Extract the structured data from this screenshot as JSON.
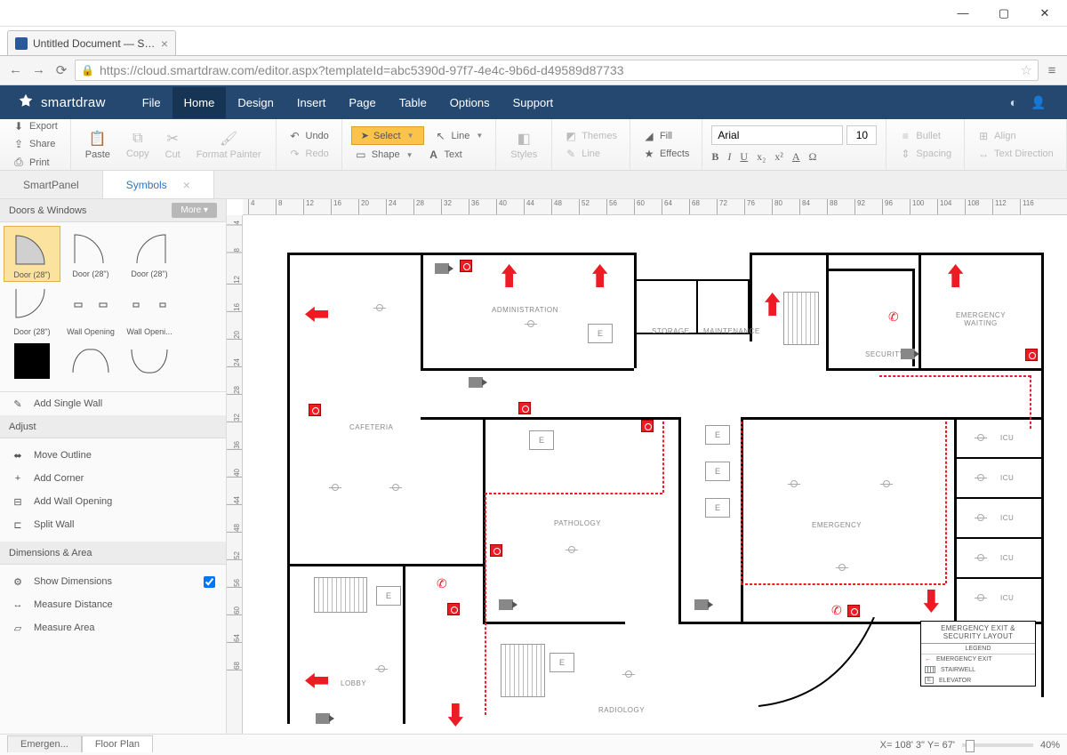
{
  "window": {
    "title": "Untitled Document — Sm..."
  },
  "browser": {
    "tab_title": "Untitled Document — Sm...",
    "url": "https://cloud.smartdraw.com/editor.aspx?templateId=abc5390d-97f7-4e4c-9b6d-d49589d87733"
  },
  "brand": "smartdraw",
  "menubar": {
    "items": [
      "File",
      "Home",
      "Design",
      "Insert",
      "Page",
      "Table",
      "Options",
      "Support"
    ],
    "active": "Home"
  },
  "ribbon": {
    "export": "Export",
    "share": "Share",
    "print": "Print",
    "paste": "Paste",
    "copy": "Copy",
    "cut": "Cut",
    "format_painter": "Format Painter",
    "undo": "Undo",
    "redo": "Redo",
    "select": "Select",
    "shape": "Shape",
    "line": "Line",
    "text": "Text",
    "styles": "Styles",
    "themes": "Themes",
    "line2": "Line",
    "fill": "Fill",
    "effects": "Effects",
    "font": "Arial",
    "font_size": "10",
    "bullet": "Bullet",
    "spacing": "Spacing",
    "align": "Align",
    "text_direction": "Text Direction"
  },
  "panel_tabs": {
    "smartpanel": "SmartPanel",
    "symbols": "Symbols"
  },
  "symbols": {
    "header": "Doors & Windows",
    "more": "More",
    "items": [
      "Door (28\")",
      "Door (28\")",
      "Door (28\")",
      "Door (28\")",
      "Wall Opening",
      "Wall Openi..."
    ],
    "add_single_wall": "Add Single Wall"
  },
  "adjust": {
    "header": "Adjust",
    "items": [
      "Move Outline",
      "Add Corner",
      "Add Wall Opening",
      "Split Wall"
    ]
  },
  "dims": {
    "header": "Dimensions & Area",
    "show": "Show Dimensions",
    "measure_dist": "Measure Distance",
    "measure_area": "Measure Area"
  },
  "rooms": {
    "administration": "ADMINISTRATION",
    "storage": "STORAGE",
    "maintenance": "MAINTENANCE",
    "security": "SECURITY",
    "emergency_waiting": "EMERGENCY WAITING",
    "cafeteria": "CAFETERIA",
    "pathology": "PATHOLOGY",
    "emergency": "EMERGENCY",
    "icu": "ICU",
    "lobby": "LOBBY",
    "radiology": "RADIOLOGY",
    "elevator_mark": "E"
  },
  "legend": {
    "title": "EMERGENCY EXIT & SECURITY LAYOUT",
    "legend_label": "LEGEND",
    "rows": [
      "EMERGENCY EXIT",
      "STAIRWELL",
      "ELEVATOR"
    ]
  },
  "ruler_marks": [
    "4",
    "8",
    "12",
    "16",
    "20",
    "24",
    "28",
    "32",
    "36",
    "40",
    "44",
    "48",
    "52",
    "56",
    "60",
    "64",
    "68",
    "72",
    "76",
    "80",
    "84",
    "88",
    "92",
    "96",
    "100",
    "104",
    "108",
    "112",
    "116"
  ],
  "vruler_marks": [
    "4",
    "8",
    "12",
    "16",
    "20",
    "24",
    "28",
    "32",
    "36",
    "40",
    "44",
    "48",
    "52",
    "56",
    "60",
    "64",
    "68"
  ],
  "status": {
    "sheet1": "Emergen...",
    "sheet2": "Floor Plan",
    "coords": "X= 108' 3\"  Y= 67'",
    "zoom": "40%"
  }
}
